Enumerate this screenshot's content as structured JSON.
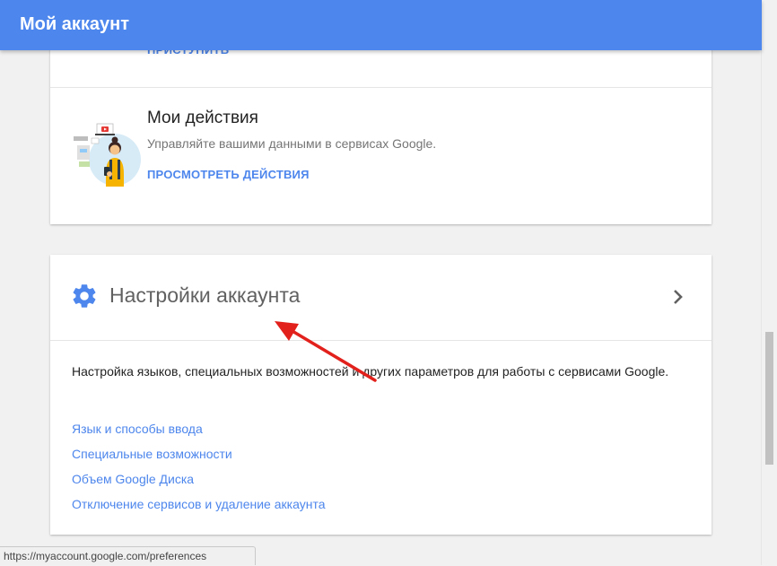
{
  "header": {
    "title": "Мой аккаунт"
  },
  "card_top": {
    "partial_link_label": "ПРИСТУПИТЬ"
  },
  "activity": {
    "title": "Мои действия",
    "description": "Управляйте вашими данными в сервисах Google.",
    "link_label": "ПРОСМОТРЕТЬ ДЕЙСТВИЯ"
  },
  "settings": {
    "title": "Настройки аккаунта",
    "description": "Настройка языков, специальных возможностей и других параметров для работы с сервисами Google.",
    "links": [
      "Язык и способы ввода",
      "Специальные возможности",
      "Объем Google Диска",
      "Отключение сервисов и удаление аккаунта"
    ]
  },
  "status_bar": {
    "url": "https://myaccount.google.com/preferences"
  },
  "colors": {
    "accent": "#4d86ec",
    "annotation_arrow": "#e2201c"
  }
}
